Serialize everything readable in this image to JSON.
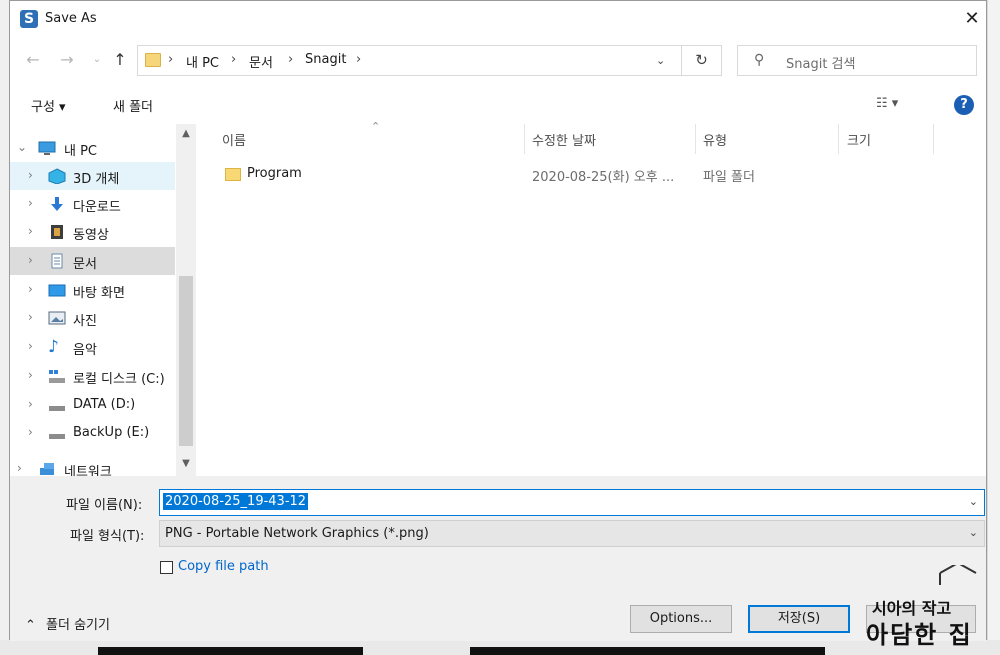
{
  "window": {
    "title": "Save As",
    "app_icon_letter": "S"
  },
  "navigation": {
    "breadcrumb": [
      "내 PC",
      "문서",
      "Snagit"
    ],
    "search_placeholder": "Snagit 검색"
  },
  "toolbar": {
    "organize": "구성 ▾",
    "new_folder": "새 폴더",
    "view_glyph": "☷ ▾"
  },
  "tree": [
    {
      "label": "내 PC",
      "icon": "pc-icon",
      "level": 0,
      "expanded": true
    },
    {
      "label": "3D 개체",
      "icon": "3d-objects-icon",
      "level": 1,
      "state": "hover"
    },
    {
      "label": "다운로드",
      "icon": "download-icon",
      "level": 1
    },
    {
      "label": "동영상",
      "icon": "video-icon",
      "level": 1
    },
    {
      "label": "문서",
      "icon": "document-icon",
      "level": 1,
      "state": "selected"
    },
    {
      "label": "바탕 화면",
      "icon": "desktop-icon",
      "level": 1
    },
    {
      "label": "사진",
      "icon": "pictures-icon",
      "level": 1
    },
    {
      "label": "음악",
      "icon": "music-icon",
      "level": 1
    },
    {
      "label": "로컬 디스크 (C:)",
      "icon": "drive-c-icon",
      "level": 1
    },
    {
      "label": "DATA (D:)",
      "icon": "drive-icon",
      "level": 1
    },
    {
      "label": "BackUp (E:)",
      "icon": "drive-icon",
      "level": 1
    },
    {
      "label": "네트워크",
      "icon": "network-icon",
      "level": 0
    }
  ],
  "columns": {
    "name": "이름",
    "modified": "수정한 날짜",
    "type": "유형",
    "size": "크기"
  },
  "files": [
    {
      "name": "Program",
      "modified": "2020-08-25(화) 오후 ...",
      "type": "파일 폴더",
      "size": ""
    }
  ],
  "form": {
    "filename_label": "파일 이름(N):",
    "filename_value": "2020-08-25_19-43-12",
    "filetype_label": "파일 형식(T):",
    "filetype_value": "PNG - Portable Network Graphics (*.png)",
    "copy_path_label": "Copy file path",
    "hide_folders": "폴더 숨기기"
  },
  "buttons": {
    "options": "Options...",
    "save": "저장(S)"
  },
  "watermark": {
    "line1": "시아의 작고",
    "line2": "아담한 집"
  },
  "colors": {
    "accent": "#0078d7",
    "help": "#1a5fb4",
    "folder": "#f8d775"
  }
}
